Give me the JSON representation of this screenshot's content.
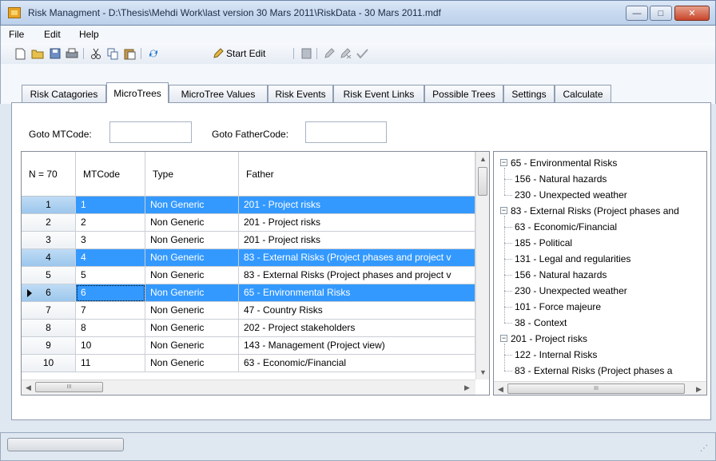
{
  "window": {
    "title": "Risk Managment - D:\\Thesis\\Mehdi Work\\last version 30 Mars 2011\\RiskData - 30 Mars 2011.mdf",
    "minimize": "—",
    "maximize": "□",
    "close": "✕"
  },
  "menu": [
    "File",
    "Edit",
    "Help"
  ],
  "toolbar": {
    "start_edit": "Start Edit",
    "icons": [
      "new-icon",
      "open-icon",
      "save-icon",
      "print-icon",
      "cut-icon",
      "copy-icon",
      "paste-icon",
      "refresh-icon",
      "edit-pencil-icon",
      "grid-icon",
      "edit-disabled-icon",
      "delete-disabled-icon",
      "check-icon"
    ]
  },
  "tabs": [
    "Risk Catagories",
    "MicroTrees",
    "MicroTree Values",
    "Risk Events",
    "Risk Event Links",
    "Possible Trees",
    "Settings",
    "Calculate"
  ],
  "active_tab": "MicroTrees",
  "goto": {
    "mtcode_label": "Goto MTCode:",
    "fathercode_label": "Goto FatherCode:",
    "mtcode_value": "",
    "fathercode_value": ""
  },
  "grid": {
    "row_header_title": "N = 70",
    "columns": [
      "MTCode",
      "Type",
      "Father"
    ],
    "rows": [
      {
        "n": "1",
        "mtcode": "1",
        "type": "Non Generic",
        "father": "201 - Project risks",
        "selected": true
      },
      {
        "n": "2",
        "mtcode": "2",
        "type": "Non Generic",
        "father": "201 - Project risks",
        "selected": false
      },
      {
        "n": "3",
        "mtcode": "3",
        "type": "Non Generic",
        "father": "201 - Project risks",
        "selected": false
      },
      {
        "n": "4",
        "mtcode": "4",
        "type": "Non Generic",
        "father": "83 - External Risks (Project phases and  project v",
        "selected": true
      },
      {
        "n": "5",
        "mtcode": "5",
        "type": "Non Generic",
        "father": "83 - External Risks (Project phases and  project v",
        "selected": false
      },
      {
        "n": "6",
        "mtcode": "6",
        "type": "Non Generic",
        "father": "65 - Environmental Risks",
        "selected": true,
        "current": true
      },
      {
        "n": "7",
        "mtcode": "7",
        "type": "Non Generic",
        "father": "47 - Country Risks",
        "selected": false
      },
      {
        "n": "8",
        "mtcode": "8",
        "type": "Non Generic",
        "father": "202 - Project stakeholders",
        "selected": false
      },
      {
        "n": "9",
        "mtcode": "10",
        "type": "Non Generic",
        "father": "143 - Management (Project view)",
        "selected": false
      },
      {
        "n": "10",
        "mtcode": "11",
        "type": "Non Generic",
        "father": "63 - Economic/Financial",
        "selected": false
      }
    ]
  },
  "tree": [
    {
      "label": "65 - Environmental Risks",
      "expander": "−",
      "children": [
        "156 - Natural hazards",
        "230 - Unexpected weather"
      ]
    },
    {
      "label": "83 - External Risks (Project phases and",
      "expander": "−",
      "children": [
        "63 - Economic/Financial",
        "185 - Political",
        "131 - Legal and regularities",
        "156 - Natural hazards",
        "230 - Unexpected weather",
        "101 - Force majeure",
        "38 - Context"
      ]
    },
    {
      "label": "201 - Project risks",
      "expander": "−",
      "children": [
        "122 - Internal Risks",
        "83 - External Risks (Project phases a"
      ]
    }
  ],
  "scroll": {
    "thumb": "III"
  }
}
